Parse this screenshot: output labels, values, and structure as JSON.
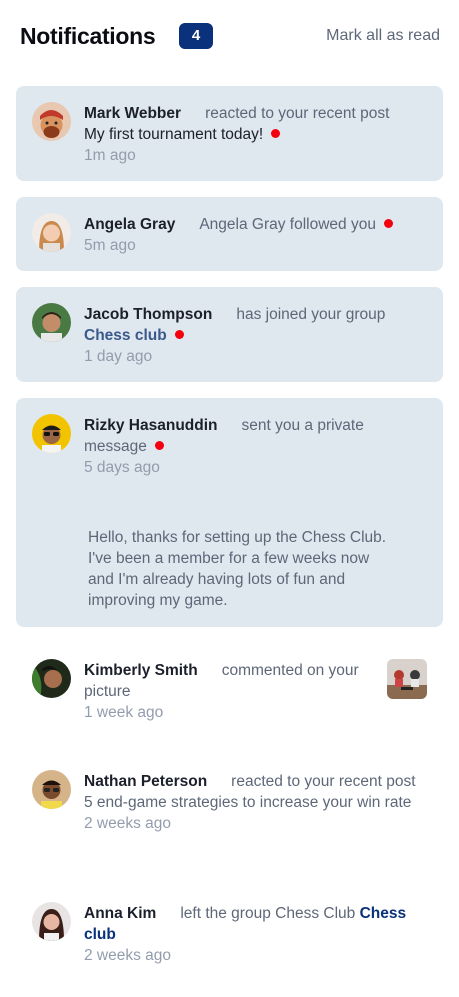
{
  "header": {
    "title": "Notifications",
    "unread_count": "4",
    "mark_all_label": "Mark all as read"
  },
  "notifications": [
    {
      "name": "Mark Webber",
      "action": "reacted to your recent post",
      "target": "My first tournament today!",
      "time": "1m ago",
      "unread": true
    },
    {
      "name": "Angela Gray",
      "action": "Angela Gray followed you",
      "time": "5m ago",
      "unread": true
    },
    {
      "name": "Jacob Thompson",
      "action": "has joined your group",
      "target": "Chess club",
      "time": "1 day ago",
      "unread": true
    },
    {
      "name": "Rizky Hasanuddin",
      "action": "sent you a private message",
      "time": "5 days ago",
      "unread": true,
      "message": "Hello, thanks for setting up the Chess Club. I've been a member for a few weeks now and I'm already having lots of fun and improving my game."
    },
    {
      "name": "Kimberly Smith",
      "action": "commented on your picture",
      "time": "1 week ago",
      "unread": false
    },
    {
      "name": "Nathan Peterson",
      "action": "reacted to your recent post 5 end-game strategies to increase your win rate",
      "time": "2 weeks ago",
      "unread": false
    },
    {
      "name": "Anna Kim",
      "action": "left the group Chess Club",
      "target": "Chess club",
      "time": "2 weeks ago",
      "unread": false
    }
  ],
  "colors": {
    "unread_bg": "#dfe7ef",
    "badge_bg": "#0a317b",
    "dot": "#f4000e",
    "group_link": "#0a317b"
  }
}
